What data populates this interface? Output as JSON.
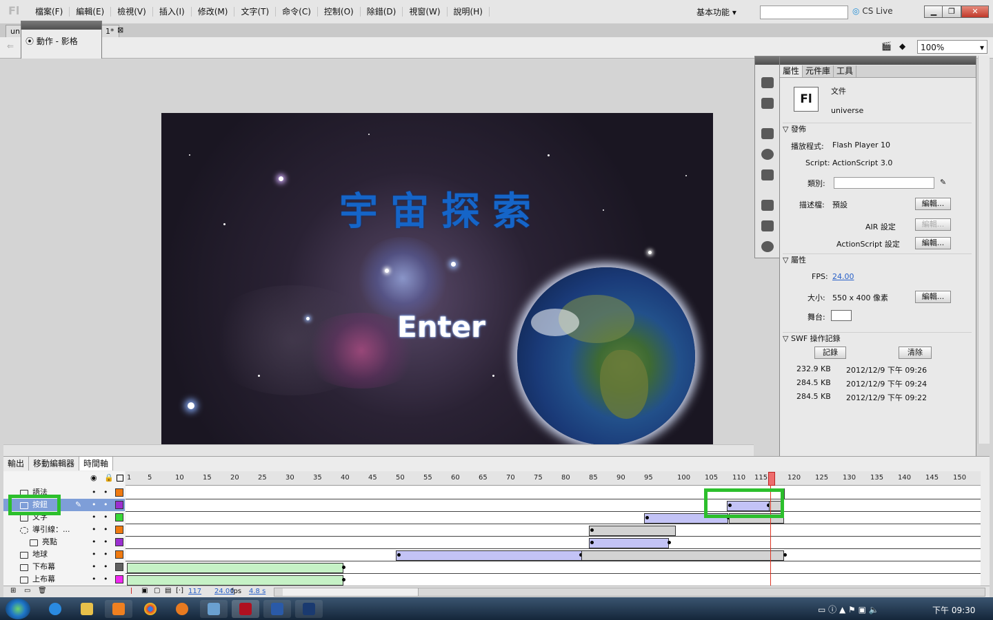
{
  "app": {
    "logo": "Fl"
  },
  "menu": [
    "檔案(F)",
    "編輯(E)",
    "檢視(V)",
    "插入(I)",
    "修改(M)",
    "文字(T)",
    "命令(C)",
    "控制(O)",
    "除錯(D)",
    "視窗(W)",
    "說明(H)"
  ],
  "topbar": {
    "workspace": "基本功能",
    "search_placeholder": "",
    "cs_live": "CS Live"
  },
  "doc_tabs": [
    "un",
    "1*"
  ],
  "action_panel": {
    "title": "動作 - 影格"
  },
  "zoom": "100%",
  "stage": {
    "title": "宇宙探索",
    "button": "Enter"
  },
  "properties": {
    "tabs": [
      "屬性",
      "元件庫",
      "工具"
    ],
    "doc_label": "文件",
    "doc_name": "universe",
    "publish": {
      "section": "發佈",
      "player_label": "播放程式:",
      "player": "Flash Player 10",
      "script_label": "Script:",
      "script": "ActionScript 3.0",
      "class_label": "類別:",
      "profile_label": "描述檔:",
      "profile": "預設",
      "edit": "編輯...",
      "air_label": "AIR 設定",
      "as_label": "ActionScript 設定"
    },
    "props": {
      "section": "屬性",
      "fps_label": "FPS:",
      "fps": "24.00",
      "size_label": "大小:",
      "size": "550 x 400 像素",
      "stage_label": "舞台:",
      "stage_color": "#ffffff"
    },
    "swf": {
      "section": "SWF 操作記錄",
      "log": "記錄",
      "clear": "清除",
      "entries": [
        {
          "size": "232.9 KB",
          "date": "2012/12/9 下午 09:26"
        },
        {
          "size": "284.5 KB",
          "date": "2012/12/9 下午 09:24"
        },
        {
          "size": "284.5 KB",
          "date": "2012/12/9 下午 09:22"
        }
      ]
    }
  },
  "timeline": {
    "tabs": [
      "輸出",
      "移動編輯器",
      "時間軸"
    ],
    "ruler": [
      "1",
      "5",
      "10",
      "15",
      "20",
      "25",
      "30",
      "35",
      "40",
      "45",
      "50",
      "55",
      "60",
      "65",
      "70",
      "75",
      "80",
      "85",
      "90",
      "95",
      "100",
      "105",
      "110",
      "115",
      "120",
      "125",
      "130",
      "135",
      "140",
      "145",
      "150"
    ],
    "layers": [
      {
        "name": "語法",
        "color": "#f07a10"
      },
      {
        "name": "按鈕",
        "color": "#9b2fd0"
      },
      {
        "name": "文字",
        "color": "#38d838"
      },
      {
        "name": "導引線：...",
        "color": "#f07a10"
      },
      {
        "name": "亮點",
        "color": "#9b2fd0"
      },
      {
        "name": "地球",
        "color": "#f07a10"
      },
      {
        "name": "下布幕",
        "color": "#606060"
      },
      {
        "name": "上布幕",
        "color": "#f028f0"
      }
    ],
    "footer": {
      "frame": "117",
      "fps": "24.00",
      "fps_unit": "fps",
      "time": "4.8 s"
    }
  },
  "taskbar": {
    "time": "下午 09:30"
  }
}
